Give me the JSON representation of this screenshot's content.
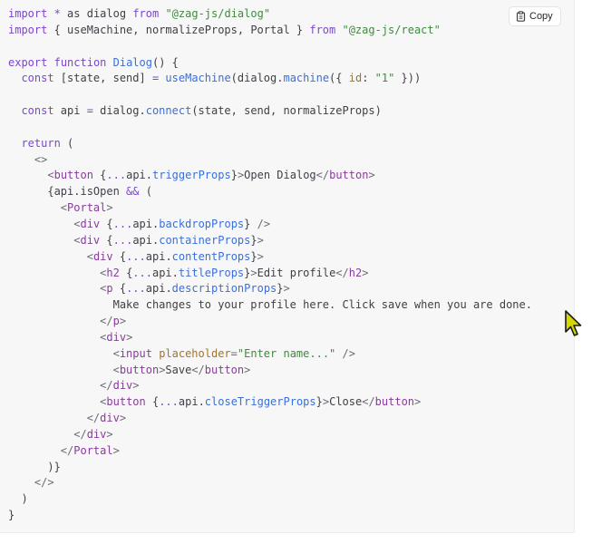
{
  "copy_button": {
    "label": "Copy",
    "icon": "clipboard-icon"
  },
  "code": {
    "language": "jsx",
    "lines": [
      [
        [
          "kw",
          "import"
        ],
        [
          "plain",
          " "
        ],
        [
          "kw",
          "*"
        ],
        [
          "plain",
          " as dialog "
        ],
        [
          "kw",
          "from"
        ],
        [
          "plain",
          " "
        ],
        [
          "str",
          "\"@zag-js/dialog\""
        ]
      ],
      [
        [
          "kw",
          "import"
        ],
        [
          "plain",
          " { useMachine, normalizeProps, Portal } "
        ],
        [
          "kw",
          "from"
        ],
        [
          "plain",
          " "
        ],
        [
          "str",
          "\"@zag-js/react\""
        ]
      ],
      [],
      [
        [
          "kw",
          "export"
        ],
        [
          "plain",
          " "
        ],
        [
          "kw",
          "function"
        ],
        [
          "plain",
          " "
        ],
        [
          "fn",
          "Dialog"
        ],
        [
          "plain",
          "() {"
        ]
      ],
      [
        [
          "plain",
          "  "
        ],
        [
          "kw",
          "const"
        ],
        [
          "plain",
          " [state, send] "
        ],
        [
          "kw",
          "="
        ],
        [
          "plain",
          " "
        ],
        [
          "fn",
          "useMachine"
        ],
        [
          "plain",
          "(dialog."
        ],
        [
          "fn",
          "machine"
        ],
        [
          "plain",
          "({ "
        ],
        [
          "attr",
          "id"
        ],
        [
          "plain",
          ": "
        ],
        [
          "str",
          "\"1\""
        ],
        [
          "plain",
          " }))"
        ]
      ],
      [],
      [
        [
          "plain",
          "  "
        ],
        [
          "kw",
          "const"
        ],
        [
          "plain",
          " api "
        ],
        [
          "kw",
          "="
        ],
        [
          "plain",
          " dialog."
        ],
        [
          "fn",
          "connect"
        ],
        [
          "plain",
          "(state, send, normalizeProps)"
        ]
      ],
      [],
      [
        [
          "plain",
          "  "
        ],
        [
          "kw",
          "return"
        ],
        [
          "plain",
          " ("
        ]
      ],
      [
        [
          "plain",
          "    "
        ],
        [
          "punct",
          "<>"
        ]
      ],
      [
        [
          "plain",
          "      "
        ],
        [
          "punct",
          "<"
        ],
        [
          "tag",
          "button"
        ],
        [
          "plain",
          " {"
        ],
        [
          "kw",
          "..."
        ],
        [
          "plain",
          "api."
        ],
        [
          "fn",
          "triggerProps"
        ],
        [
          "plain",
          "}"
        ],
        [
          "punct",
          ">"
        ],
        [
          "plain",
          "Open Dialog"
        ],
        [
          "punct",
          "</"
        ],
        [
          "tag",
          "button"
        ],
        [
          "punct",
          ">"
        ]
      ],
      [
        [
          "plain",
          "      {api.isOpen "
        ],
        [
          "kw",
          "&&"
        ],
        [
          "plain",
          " ("
        ]
      ],
      [
        [
          "plain",
          "        "
        ],
        [
          "punct",
          "<"
        ],
        [
          "tag",
          "Portal"
        ],
        [
          "punct",
          ">"
        ]
      ],
      [
        [
          "plain",
          "          "
        ],
        [
          "punct",
          "<"
        ],
        [
          "tag",
          "div"
        ],
        [
          "plain",
          " {"
        ],
        [
          "kw",
          "..."
        ],
        [
          "plain",
          "api."
        ],
        [
          "fn",
          "backdropProps"
        ],
        [
          "plain",
          "} "
        ],
        [
          "punct",
          "/>"
        ]
      ],
      [
        [
          "plain",
          "          "
        ],
        [
          "punct",
          "<"
        ],
        [
          "tag",
          "div"
        ],
        [
          "plain",
          " {"
        ],
        [
          "kw",
          "..."
        ],
        [
          "plain",
          "api."
        ],
        [
          "fn",
          "containerProps"
        ],
        [
          "plain",
          "}"
        ],
        [
          "punct",
          ">"
        ]
      ],
      [
        [
          "plain",
          "            "
        ],
        [
          "punct",
          "<"
        ],
        [
          "tag",
          "div"
        ],
        [
          "plain",
          " {"
        ],
        [
          "kw",
          "..."
        ],
        [
          "plain",
          "api."
        ],
        [
          "fn",
          "contentProps"
        ],
        [
          "plain",
          "}"
        ],
        [
          "punct",
          ">"
        ]
      ],
      [
        [
          "plain",
          "              "
        ],
        [
          "punct",
          "<"
        ],
        [
          "tag",
          "h2"
        ],
        [
          "plain",
          " {"
        ],
        [
          "kw",
          "..."
        ],
        [
          "plain",
          "api."
        ],
        [
          "fn",
          "titleProps"
        ],
        [
          "plain",
          "}"
        ],
        [
          "punct",
          ">"
        ],
        [
          "plain",
          "Edit profile"
        ],
        [
          "punct",
          "</"
        ],
        [
          "tag",
          "h2"
        ],
        [
          "punct",
          ">"
        ]
      ],
      [
        [
          "plain",
          "              "
        ],
        [
          "punct",
          "<"
        ],
        [
          "tag",
          "p"
        ],
        [
          "plain",
          " {"
        ],
        [
          "kw",
          "..."
        ],
        [
          "plain",
          "api."
        ],
        [
          "fn",
          "descriptionProps"
        ],
        [
          "plain",
          "}"
        ],
        [
          "punct",
          ">"
        ]
      ],
      [
        [
          "plain",
          "                Make changes to your profile here. Click save when you are done."
        ]
      ],
      [
        [
          "plain",
          "              "
        ],
        [
          "punct",
          "</"
        ],
        [
          "tag",
          "p"
        ],
        [
          "punct",
          ">"
        ]
      ],
      [
        [
          "plain",
          "              "
        ],
        [
          "punct",
          "<"
        ],
        [
          "tag",
          "div"
        ],
        [
          "punct",
          ">"
        ]
      ],
      [
        [
          "plain",
          "                "
        ],
        [
          "punct",
          "<"
        ],
        [
          "tag",
          "input"
        ],
        [
          "plain",
          " "
        ],
        [
          "attr",
          "placeholder"
        ],
        [
          "punct",
          "="
        ],
        [
          "str",
          "\"Enter name...\""
        ],
        [
          "plain",
          " "
        ],
        [
          "punct",
          "/>"
        ]
      ],
      [
        [
          "plain",
          "                "
        ],
        [
          "punct",
          "<"
        ],
        [
          "tag",
          "button"
        ],
        [
          "punct",
          ">"
        ],
        [
          "plain",
          "Save"
        ],
        [
          "punct",
          "</"
        ],
        [
          "tag",
          "button"
        ],
        [
          "punct",
          ">"
        ]
      ],
      [
        [
          "plain",
          "              "
        ],
        [
          "punct",
          "</"
        ],
        [
          "tag",
          "div"
        ],
        [
          "punct",
          ">"
        ]
      ],
      [
        [
          "plain",
          "              "
        ],
        [
          "punct",
          "<"
        ],
        [
          "tag",
          "button"
        ],
        [
          "plain",
          " {"
        ],
        [
          "kw",
          "..."
        ],
        [
          "plain",
          "api."
        ],
        [
          "fn",
          "closeTriggerProps"
        ],
        [
          "plain",
          "}"
        ],
        [
          "punct",
          ">"
        ],
        [
          "plain",
          "Close"
        ],
        [
          "punct",
          "</"
        ],
        [
          "tag",
          "button"
        ],
        [
          "punct",
          ">"
        ]
      ],
      [
        [
          "plain",
          "            "
        ],
        [
          "punct",
          "</"
        ],
        [
          "tag",
          "div"
        ],
        [
          "punct",
          ">"
        ]
      ],
      [
        [
          "plain",
          "          "
        ],
        [
          "punct",
          "</"
        ],
        [
          "tag",
          "div"
        ],
        [
          "punct",
          ">"
        ]
      ],
      [
        [
          "plain",
          "        "
        ],
        [
          "punct",
          "</"
        ],
        [
          "tag",
          "Portal"
        ],
        [
          "punct",
          ">"
        ]
      ],
      [
        [
          "plain",
          "      )}"
        ]
      ],
      [
        [
          "plain",
          "    "
        ],
        [
          "punct",
          "</>"
        ]
      ],
      [
        [
          "plain",
          "  )"
        ]
      ],
      [
        [
          "plain",
          "}"
        ]
      ]
    ]
  }
}
